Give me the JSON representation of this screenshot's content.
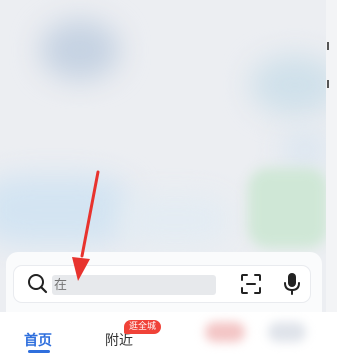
{
  "search": {
    "placeholder": "在"
  },
  "tabbar": {
    "home_label": "首页",
    "nearby_label": "附近",
    "nearby_badge": "逛全城"
  },
  "colors": {
    "accent": "#2f6fdd",
    "badge": "#f04238",
    "annotation_arrow": "#e8332e"
  },
  "icons": {
    "search": "search-icon",
    "scan": "scan-icon",
    "mic": "microphone-icon"
  }
}
